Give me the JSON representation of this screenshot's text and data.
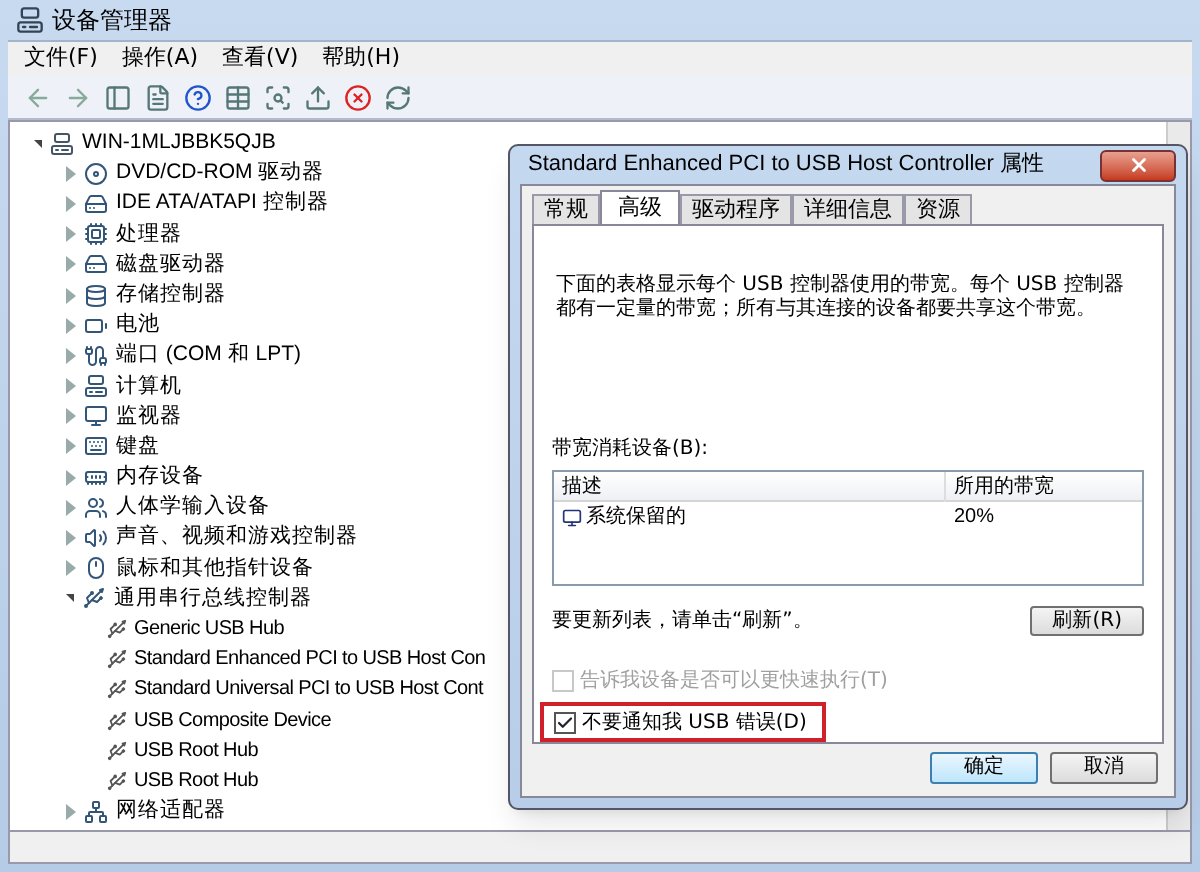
{
  "window": {
    "title": "设备管理器"
  },
  "menu": [
    "文件(F)",
    "操作(A)",
    "查看(V)",
    "帮助(H)"
  ],
  "tree": {
    "label": "WIN-1MLJBBK5QJB",
    "expanded": true,
    "children": [
      {
        "label": "DVD/CD-ROM 驱动器",
        "expanded": false
      },
      {
        "label": "IDE ATA/ATAPI 控制器",
        "expanded": false
      },
      {
        "label": "处理器",
        "expanded": false
      },
      {
        "label": "磁盘驱动器",
        "expanded": false
      },
      {
        "label": "存储控制器",
        "expanded": false
      },
      {
        "label": "电池",
        "expanded": false
      },
      {
        "label": "端口 (COM 和 LPT)",
        "expanded": false
      },
      {
        "label": "计算机",
        "expanded": false
      },
      {
        "label": "监视器",
        "expanded": false
      },
      {
        "label": "键盘",
        "expanded": false
      },
      {
        "label": "内存设备",
        "expanded": false
      },
      {
        "label": "人体学输入设备",
        "expanded": false
      },
      {
        "label": "声音、视频和游戏控制器",
        "expanded": false
      },
      {
        "label": "鼠标和其他指针设备",
        "expanded": false
      },
      {
        "label": "通用串行总线控制器",
        "expanded": true,
        "children": [
          {
            "label": "Generic USB Hub"
          },
          {
            "label": "Standard Enhanced PCI to USB Host Con"
          },
          {
            "label": "Standard Universal PCI to USB Host Cont"
          },
          {
            "label": "USB Composite Device"
          },
          {
            "label": "USB Root Hub"
          },
          {
            "label": "USB Root Hub"
          }
        ]
      },
      {
        "label": "网络适配器",
        "expanded": false
      }
    ]
  },
  "dialog": {
    "title": "Standard Enhanced PCI to USB Host Controller 属性",
    "tabs": [
      {
        "label": "常规",
        "selected": false
      },
      {
        "label": "高级",
        "selected": true
      },
      {
        "label": "驱动程序",
        "selected": false
      },
      {
        "label": "详细信息",
        "selected": false
      },
      {
        "label": "资源",
        "selected": false
      }
    ],
    "description": "下面的表格显示每个 USB 控制器使用的带宽。每个 USB 控制器都有一定量的带宽；所有与其连接的设备都要共享这个带宽。",
    "list_label": "带宽消耗设备(B):",
    "columns": [
      "描述",
      "所用的带宽"
    ],
    "rows": [
      {
        "description": "系统保留的",
        "bandwidth": "20%"
      }
    ],
    "refresh_hint": "要更新列表，请单击“刷新”。",
    "refresh_button": "刷新(R)",
    "checkboxes": [
      {
        "label": "告诉我设备是否可以更快速执行(T)",
        "checked": false,
        "disabled": true,
        "highlighted": false
      },
      {
        "label": "不要通知我 USB 错误(D)",
        "checked": true,
        "disabled": false,
        "highlighted": true
      }
    ],
    "buttons": [
      {
        "label": "确定",
        "selected": true
      },
      {
        "label": "取消",
        "selected": false
      }
    ]
  }
}
